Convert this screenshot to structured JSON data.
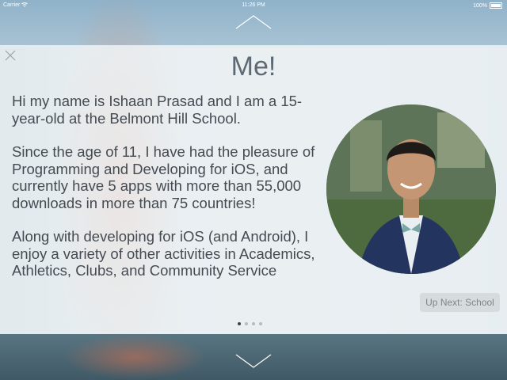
{
  "status_bar": {
    "carrier": "Carrier",
    "time": "11:26 PM",
    "battery": "100%"
  },
  "card": {
    "title": "Me!",
    "paragraphs": [
      "Hi my name is Ishaan Prasad and I am a 15-year-old at the Belmont Hill School.",
      "Since the age of 11, I have had the pleasure of Programming and Developing for iOS, and currently have 5 apps with more than 55,000 downloads in more than 75 countries!",
      "Along with developing for iOS (and Android), I enjoy a variety of other activities in Academics, Athletics, Clubs, and Community Service"
    ],
    "up_next": "Up Next: School"
  },
  "pager": {
    "current_page": 1,
    "total_pages": 4
  },
  "icons": {
    "close": "close-icon",
    "nav_up": "chevron-up-icon",
    "nav_down": "chevron-down-icon",
    "wifi": "wifi-icon",
    "battery": "battery-icon"
  }
}
